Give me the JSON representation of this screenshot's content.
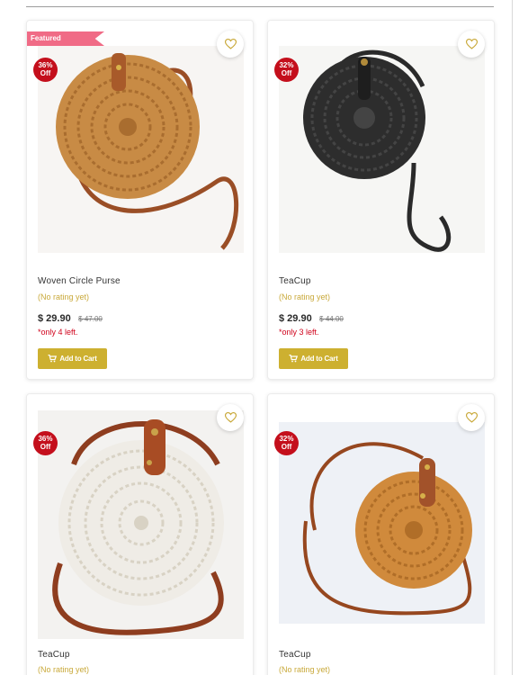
{
  "colors": {
    "accent_gold": "#cdb030",
    "sale_red": "#c40f1c",
    "featured_pink": "#f06b86",
    "stock_red": "#d0021b"
  },
  "products": [
    {
      "featured_label": "Featured",
      "discount": {
        "percent": "36%",
        "word": "Off"
      },
      "name": "Woven Circle Purse",
      "rating": "(No rating yet)",
      "price": "$ 29.90",
      "old_price": "$ 47.00",
      "stock": "*only 4 left.",
      "cart_label": "Add to Cart",
      "cart_icon": "shopping-cart-icon",
      "wish_icon": "heart-outline-icon"
    },
    {
      "discount": {
        "percent": "32%",
        "word": "Off"
      },
      "name": "TeaCup",
      "rating": "(No rating yet)",
      "price": "$ 29.90",
      "old_price": "$ 44.00",
      "stock": "*only 3 left.",
      "cart_label": "Add to Cart",
      "cart_icon": "shopping-cart-icon",
      "wish_icon": "heart-outline-icon"
    },
    {
      "discount": {
        "percent": "36%",
        "word": "Off"
      },
      "name": "TeaCup",
      "rating": "(No rating yet)",
      "wish_icon": "heart-outline-icon"
    },
    {
      "discount": {
        "percent": "32%",
        "word": "Off"
      },
      "name": "TeaCup",
      "rating": "(No rating yet)",
      "wish_icon": "heart-outline-icon"
    }
  ]
}
